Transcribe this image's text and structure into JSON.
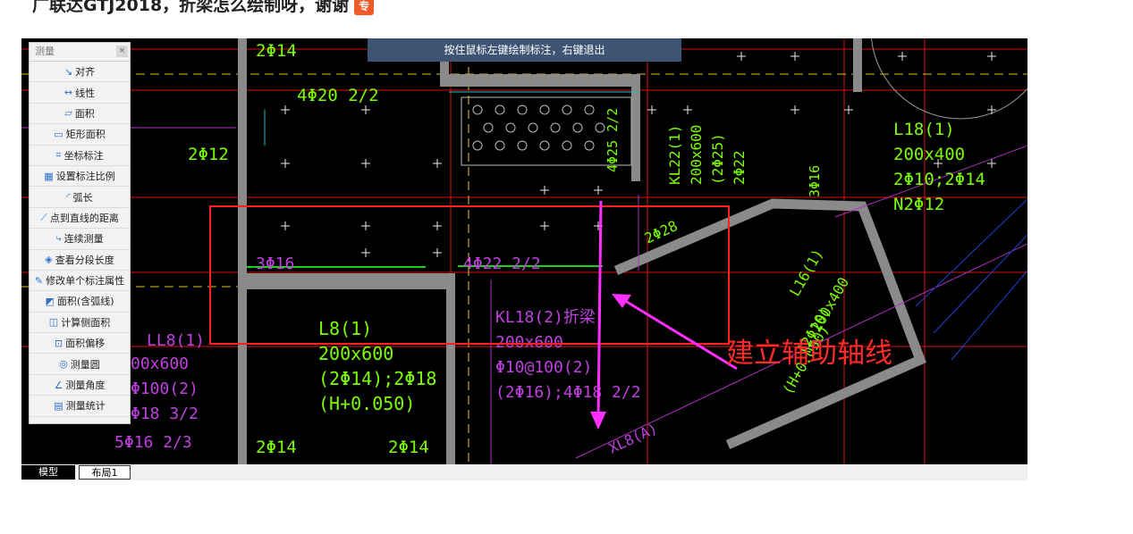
{
  "question": {
    "text": "广联达GTJ2018，折梁怎么绘制呀，谢谢",
    "badge": "专"
  },
  "hint_bar": {
    "text": "按住鼠标左键绘制标注，右键退出"
  },
  "panel": {
    "title": "测量",
    "close": "×",
    "tools": [
      {
        "icon": "↘",
        "label": "对齐"
      },
      {
        "icon": "↔",
        "label": "线性"
      },
      {
        "icon": "▱",
        "label": "面积"
      },
      {
        "icon": "▭",
        "label": "矩形面积"
      },
      {
        "icon": "⌗",
        "label": "坐标标注"
      },
      {
        "icon": "▦",
        "label": "设置标注比例"
      },
      {
        "icon": "◜",
        "label": "弧长"
      },
      {
        "icon": "⟋",
        "label": "点到直线的距离"
      },
      {
        "icon": "⤷",
        "label": "连续测量"
      },
      {
        "icon": "◈",
        "label": "查看分段长度"
      },
      {
        "icon": "✎",
        "label": "修改单个标注属性"
      },
      {
        "icon": "◩",
        "label": "面积(含弧线)"
      },
      {
        "icon": "◫",
        "label": "计算侧面积"
      },
      {
        "icon": "⊡",
        "label": "面积偏移"
      },
      {
        "icon": "◎",
        "label": "测量圆"
      },
      {
        "icon": "∠",
        "label": "测量角度"
      },
      {
        "icon": "▤",
        "label": "测量统计"
      }
    ]
  },
  "tabs": {
    "model": "模型",
    "layout": "布局1"
  },
  "annotation": {
    "text": "建立辅助轴线"
  },
  "cad_labels": {
    "t1": "2Φ14",
    "t2": "4Φ20 2/2",
    "t3": "2Φ12",
    "t4": "3Φ16",
    "t5": "4Φ22 2/2",
    "t6": "L8(1)",
    "t7": "200x600",
    "t8": "(2Φ14);2Φ18",
    "t9": "(H+0.050)",
    "t10": "2Φ14",
    "t11": "2Φ14",
    "t12": "KL18(2)折梁",
    "t13": "200x600",
    "t14": "Φ10@100(2)",
    "t15": "(2Φ16);4Φ18 2/2",
    "t16": "L18(1)",
    "t17": "200x400",
    "t18": "2Φ10;2Φ14",
    "t19": "N2Φ12",
    "t20": "KL22(1)",
    "t21": "200x600",
    "t22": "(2Φ25)",
    "t23": "2Φ22",
    "t24": "LL8(1)",
    "t25": "00x600",
    "t26": "Φ100(2)",
    "t27": "Φ18 3/2",
    "t28": "5Φ16 2/3",
    "t29": "XL8(A)",
    "t30": "2Φ28",
    "t31": "L16(1)",
    "t32": "200x400",
    "t33": "(2Φ10)",
    "t34": "(H+0.050)",
    "t35": "4Φ25 2/2",
    "t36": "3Φ16"
  }
}
